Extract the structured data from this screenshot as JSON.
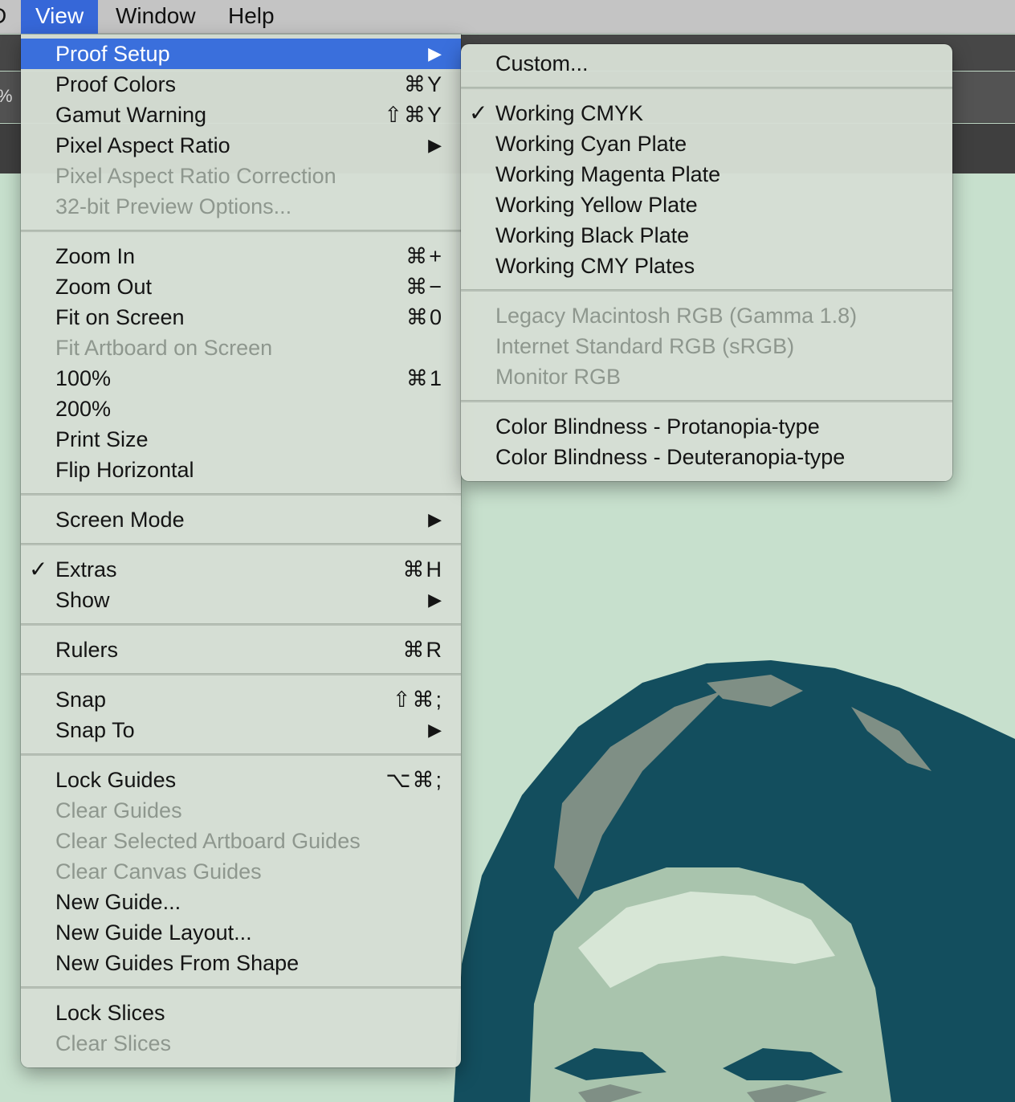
{
  "menubar": {
    "edge_fragment": "D",
    "items": [
      {
        "label": "View",
        "active": true
      },
      {
        "label": "Window",
        "active": false
      },
      {
        "label": "Help",
        "active": false
      }
    ]
  },
  "toolbar": {
    "zoom_fragment": "%"
  },
  "colors": {
    "accent": "#3a6fdc",
    "canvas_bg": "#c7e0cd",
    "portrait_dark": "#134e5e",
    "portrait_mid": "#7f8f85",
    "portrait_light": "#a9c4ad"
  },
  "view_menu": {
    "groups": [
      [
        {
          "label": "Proof Setup",
          "submenu": true,
          "highlighted": true
        },
        {
          "label": "Proof Colors",
          "shortcut": "⌘Y"
        },
        {
          "label": "Gamut Warning",
          "shortcut": "⇧⌘Y"
        },
        {
          "label": "Pixel Aspect Ratio",
          "submenu": true
        },
        {
          "label": "Pixel Aspect Ratio Correction",
          "disabled": true
        },
        {
          "label": "32-bit Preview Options...",
          "disabled": true
        }
      ],
      [
        {
          "label": "Zoom In",
          "shortcut": "⌘+"
        },
        {
          "label": "Zoom Out",
          "shortcut": "⌘−"
        },
        {
          "label": "Fit on Screen",
          "shortcut": "⌘0"
        },
        {
          "label": "Fit Artboard on Screen",
          "disabled": true
        },
        {
          "label": "100%",
          "shortcut": "⌘1"
        },
        {
          "label": "200%"
        },
        {
          "label": "Print Size"
        },
        {
          "label": "Flip Horizontal"
        }
      ],
      [
        {
          "label": "Screen Mode",
          "submenu": true
        }
      ],
      [
        {
          "label": "Extras",
          "shortcut": "⌘H",
          "checked": true
        },
        {
          "label": "Show",
          "submenu": true
        }
      ],
      [
        {
          "label": "Rulers",
          "shortcut": "⌘R"
        }
      ],
      [
        {
          "label": "Snap",
          "shortcut": "⇧⌘;"
        },
        {
          "label": "Snap To",
          "submenu": true
        }
      ],
      [
        {
          "label": "Lock Guides",
          "shortcut": "⌥⌘;"
        },
        {
          "label": "Clear Guides",
          "disabled": true
        },
        {
          "label": "Clear Selected Artboard Guides",
          "disabled": true
        },
        {
          "label": "Clear Canvas Guides",
          "disabled": true
        },
        {
          "label": "New Guide..."
        },
        {
          "label": "New Guide Layout..."
        },
        {
          "label": "New Guides From Shape"
        }
      ],
      [
        {
          "label": "Lock Slices"
        },
        {
          "label": "Clear Slices",
          "disabled": true
        }
      ]
    ]
  },
  "proof_setup_submenu": {
    "groups": [
      [
        {
          "label": "Custom..."
        }
      ],
      [
        {
          "label": "Working CMYK",
          "checked": true
        },
        {
          "label": "Working Cyan Plate"
        },
        {
          "label": "Working Magenta Plate"
        },
        {
          "label": "Working Yellow Plate"
        },
        {
          "label": "Working Black Plate"
        },
        {
          "label": "Working CMY Plates"
        }
      ],
      [
        {
          "label": "Legacy Macintosh RGB (Gamma 1.8)",
          "disabled": true
        },
        {
          "label": "Internet Standard RGB (sRGB)",
          "disabled": true
        },
        {
          "label": "Monitor RGB",
          "disabled": true
        }
      ],
      [
        {
          "label": "Color Blindness - Protanopia-type"
        },
        {
          "label": "Color Blindness - Deuteranopia-type"
        }
      ]
    ]
  },
  "glyphs": {
    "check": "✓",
    "submenu_arrow": "▶"
  }
}
